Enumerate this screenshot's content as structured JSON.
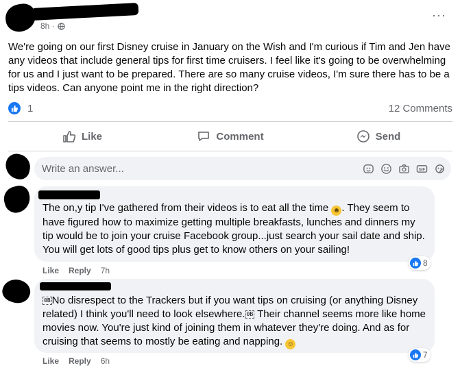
{
  "post": {
    "time": "8h ·",
    "more": "···",
    "text": "We're going on our first Disney cruise in January on the Wish and I'm curious if Tim and Jen have any videos that include general tips for first time cruisers. I feel like it's going to be overwhelming for us and I just want to be prepared. There are so many cruise videos, I'm sure there has to be a tips videos. Can anyone point me in the right direction?",
    "like_count": "1",
    "comments_count": "12 Comments"
  },
  "actions": {
    "like": "Like",
    "comment": "Comment",
    "send": "Send"
  },
  "write_box": {
    "placeholder": "Write an answer..."
  },
  "comments": [
    {
      "text_before_emoji": "The on,y tip I've gathered from their videos is to eat all the time ",
      "text_after_emoji": ". They seem to have figured how to maximize getting multiple breakfasts, lunches and dinners my tip would be to join your cruise Facebook group...just search your sail date and ship. You will get lots of good tips plus get to know others on your sailing!",
      "like_label": "Like",
      "reply_label": "Reply",
      "time": "7h",
      "reactions": "8"
    },
    {
      "glyph": "0B",
      "text_part1": "No disrespect to the Trackers but if you want tips on cruising (or anything Disney related) I think you'll need to look elsewhere.",
      "text_part2": " Their channel seems more like home movies now. You're just kind of joining them in whatever they're doing. And as for cruising that seems to mostly be eating and napping. ",
      "like_label": "Like",
      "reply_label": "Reply",
      "time": "6h",
      "reactions": "7"
    }
  ],
  "colors": {
    "accent": "#1877f2",
    "secondary_text": "#65676b",
    "bubble": "#f0f2f5"
  }
}
